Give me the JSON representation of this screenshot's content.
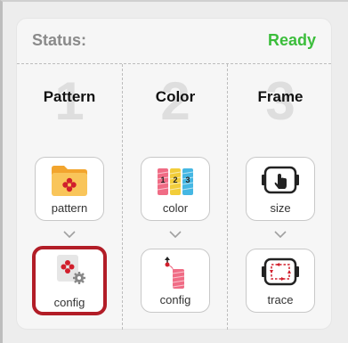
{
  "status": {
    "label": "Status:",
    "value": "Ready",
    "value_color": "#3bbd3b"
  },
  "columns": [
    {
      "number": "1",
      "heading": "Pattern",
      "top_button": {
        "label": "pattern",
        "icon": "pattern-folder-icon"
      },
      "bottom_button": {
        "label": "config",
        "icon": "pattern-config-icon",
        "selected": true
      }
    },
    {
      "number": "2",
      "heading": "Color",
      "top_button": {
        "label": "color",
        "icon": "thread-spools-icon",
        "spool_numbers": [
          "1",
          "2",
          "3"
        ]
      },
      "bottom_button": {
        "label": "config",
        "icon": "color-config-icon"
      }
    },
    {
      "number": "3",
      "heading": "Frame",
      "top_button": {
        "label": "size",
        "icon": "hoop-size-icon"
      },
      "bottom_button": {
        "label": "trace",
        "icon": "hoop-trace-icon"
      }
    }
  ],
  "colors": {
    "accent_red": "#b21d27",
    "ready_green": "#3bbd3b"
  }
}
